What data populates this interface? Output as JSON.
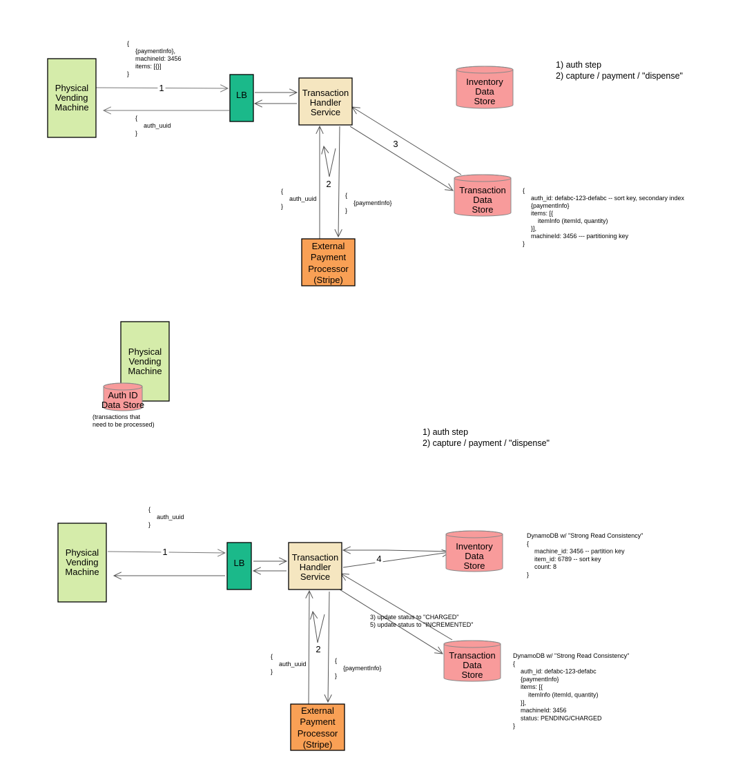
{
  "colors": {
    "vending_machine": "#d5ecaa",
    "load_balancer": "#1bb98a",
    "service": "#f5e6c0",
    "data_store": "#f89b9b",
    "payment_processor": "#f9a055",
    "arrow": "#555555"
  },
  "diagram_top": {
    "vending_machine": [
      "Physical",
      "Vending",
      "Machine"
    ],
    "lb": [
      "LB"
    ],
    "service": [
      "Transaction",
      "Handler",
      "Service"
    ],
    "inventory_store": [
      "Inventory",
      "Data",
      "Store"
    ],
    "transaction_store": [
      "Transaction",
      "Data",
      "Store"
    ],
    "payment_processor": [
      "External",
      "Payment",
      "Processor",
      "(Stripe)"
    ],
    "edge_labels": {
      "step1": "1",
      "step2": "2",
      "step3": "3"
    },
    "request_note": [
      "{",
      "{paymentInfo},",
      "machineId: 3456",
      "items: [{}]",
      "}"
    ],
    "response_note": [
      "{",
      "auth_uuid",
      "}"
    ],
    "processor_response_note": [
      "{",
      "auth_uuid",
      "}"
    ],
    "processor_request_note": [
      "{",
      "{paymentInfo}",
      "}"
    ],
    "steps": [
      "1) auth step",
      "2) capture / payment / \"dispense\""
    ],
    "transaction_schema": [
      "{",
      "auth_id: defabc-123-defabc   --   sort key, secondary index",
      "{paymentInfo}",
      "items: [{",
      "itemInfo (itemId, quantity)",
      "}],",
      "machineId: 3456 --- partitioning key",
      "}"
    ]
  },
  "diagram_middle": {
    "vending_machine": [
      "Physical",
      "Vending",
      "Machine"
    ],
    "auth_store": [
      "Auth ID",
      "Data Store"
    ],
    "caption": [
      "(transactions that",
      "need to be processed)"
    ],
    "steps": [
      "1) auth step",
      "2) capture / payment / \"dispense\""
    ]
  },
  "diagram_bottom": {
    "vending_machine": [
      "Physical",
      "Vending",
      "Machine"
    ],
    "lb": [
      "LB"
    ],
    "service": [
      "Transaction",
      "Handler",
      "Service"
    ],
    "inventory_store": [
      "Inventory",
      "Data",
      "Store"
    ],
    "transaction_store": [
      "Transaction",
      "Data",
      "Store"
    ],
    "payment_processor": [
      "External",
      "Payment",
      "Processor",
      "(Stripe)"
    ],
    "edge_labels": {
      "step1": "1",
      "step2": "2",
      "step4": "4"
    },
    "status_updates": [
      "3) update status to \"CHARGED\"",
      "5) update status to \"INCREMENTED\""
    ],
    "response_note": [
      "{",
      "auth_uuid",
      "}"
    ],
    "processor_response_note": [
      "{",
      "auth_uuid",
      "}"
    ],
    "processor_request_note": [
      "{",
      "{paymentInfo}",
      "}"
    ],
    "inventory_schema": [
      "DynamoDB w/ \"Strong Read Consistency\"",
      "{",
      "machine_id: 3456 -- partition key",
      "item_id: 6789 -- sort key",
      "count: 8",
      "}"
    ],
    "transaction_schema": [
      "DynamoDB w/ \"Strong Read Consistency\"",
      "{",
      "auth_id: defabc-123-defabc",
      "{paymentInfo}",
      "items: [{",
      "itemInfo (itemId, quantity)",
      "}],",
      "machineId: 3456",
      "status: PENDING/CHARGED",
      "}"
    ]
  }
}
